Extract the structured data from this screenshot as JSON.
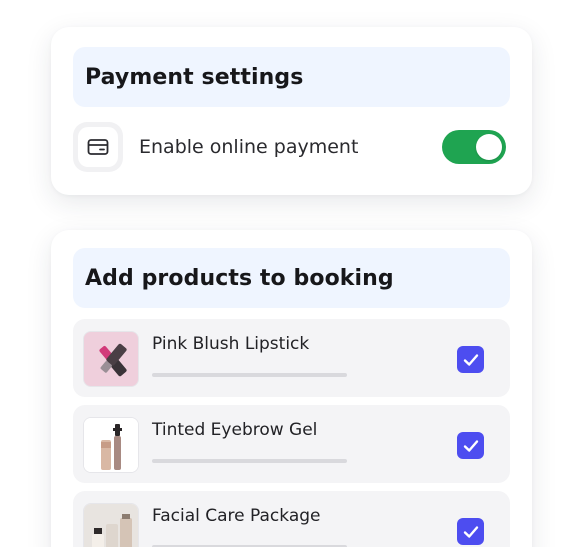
{
  "payment": {
    "title": "Payment settings",
    "option_label": "Enable online payment",
    "option_enabled": true,
    "icon": "credit-card-icon"
  },
  "products": {
    "title": "Add products to booking",
    "items": [
      {
        "name": "Pink Blush Lipstick",
        "checked": true,
        "image": "lipstick-image"
      },
      {
        "name": "Tinted Eyebrow Gel",
        "checked": true,
        "image": "eyebrow-gel-image"
      },
      {
        "name": "Facial Care Package",
        "checked": true,
        "image": "facial-care-image"
      }
    ]
  },
  "colors": {
    "accent": "#4d4df0",
    "toggle_on": "#1fa451",
    "header_band": "#eff5ff"
  }
}
